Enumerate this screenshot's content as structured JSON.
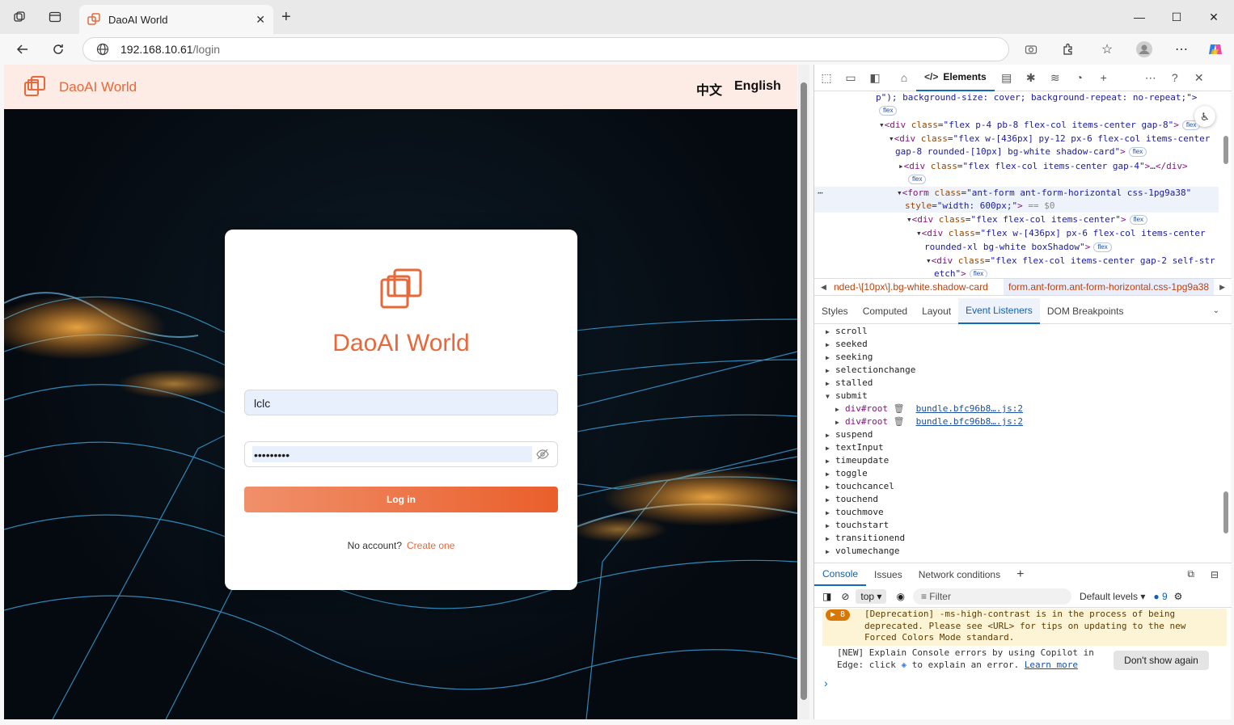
{
  "browser": {
    "tab_title": "DaoAI World",
    "address_host": "192.168.10.61",
    "address_path": "/login"
  },
  "page": {
    "brand": "DaoAI World",
    "lang_zh": "中文",
    "lang_en": "English",
    "card_title": "DaoAI World",
    "username_value": "lclc",
    "password_value": "•••••••••",
    "login_label": "Log in",
    "no_account": "No account?",
    "create_one": "Create one"
  },
  "devtools": {
    "elements_tab": "Elements",
    "code_lines": [
      {
        "text": "p\"); background-size: cover; background-repeat: no-repeat;\">",
        "badge": ""
      },
      {
        "text": "flex",
        "badge": "",
        "onlybadge": true
      },
      {
        "text": "<div class=\"flex p-4 pb-8 flex-col items-center gap-8\">",
        "badge": "flex"
      },
      {
        "text": "<div class=\"flex w-[436px] py-12 px-6 flex-col items-center",
        "badge": ""
      },
      {
        "text": "gap-8 rounded-[10px] bg-white shadow-card\">",
        "badge": "flex"
      },
      {
        "text": "<div class=\"flex flex-col items-center gap-4\">…</div>",
        "badge": ""
      },
      {
        "text": "flex",
        "badge": "",
        "onlybadge": true
      },
      {
        "text": "<form class=\"ant-form ant-form-horizontal css-1pg9a38\"",
        "badge": ""
      },
      {
        "text": "style=\"width: 600px;\"> == $0",
        "badge": ""
      },
      {
        "text": "<div class=\"flex flex-col items-center\">",
        "badge": "flex"
      },
      {
        "text": "<div class=\"flex w-[436px] px-6 flex-col items-center",
        "badge": ""
      },
      {
        "text": "rounded-xl bg-white boxShadow\">",
        "badge": "flex"
      },
      {
        "text": "<div class=\"flex flex-col items-center gap-2 self-str",
        "badge": ""
      },
      {
        "text": "etch\">",
        "badge": "flex"
      }
    ],
    "crumb_1": "nded-\\[10px\\].bg-white.shadow-card",
    "crumb_2": "form.ant-form.ant-form-horizontal.css-1pg9a38",
    "subtabs": [
      "Styles",
      "Computed",
      "Layout",
      "Event Listeners",
      "DOM Breakpoints"
    ],
    "events": [
      "scroll",
      "seeked",
      "seeking",
      "selectionchange",
      "stalled",
      "submit",
      "div#root",
      "div#root",
      "suspend",
      "textInput",
      "timeupdate",
      "toggle",
      "touchcancel",
      "touchend",
      "touchmove",
      "touchstart",
      "transitionend",
      "volumechange"
    ],
    "listener_link": "bundle.bfc96b8….js:2",
    "console_tabs": [
      "Console",
      "Issues",
      "Network conditions"
    ],
    "context": "top",
    "filter_placeholder": "Filter",
    "levels": "Default levels",
    "issue_count": "9",
    "warn_count": "8",
    "warning_text": "[Deprecation] -ms-high-contrast is in the process of being deprecated. Please see <URL> for tips on updating to the new Forced Colors Mode standard.",
    "new_msg_1": "[NEW] Explain Console errors by using Copilot in Edge: click",
    "new_msg_2": "to explain an error.",
    "learn_more": "Learn more",
    "dont_show": "Don't show again"
  }
}
